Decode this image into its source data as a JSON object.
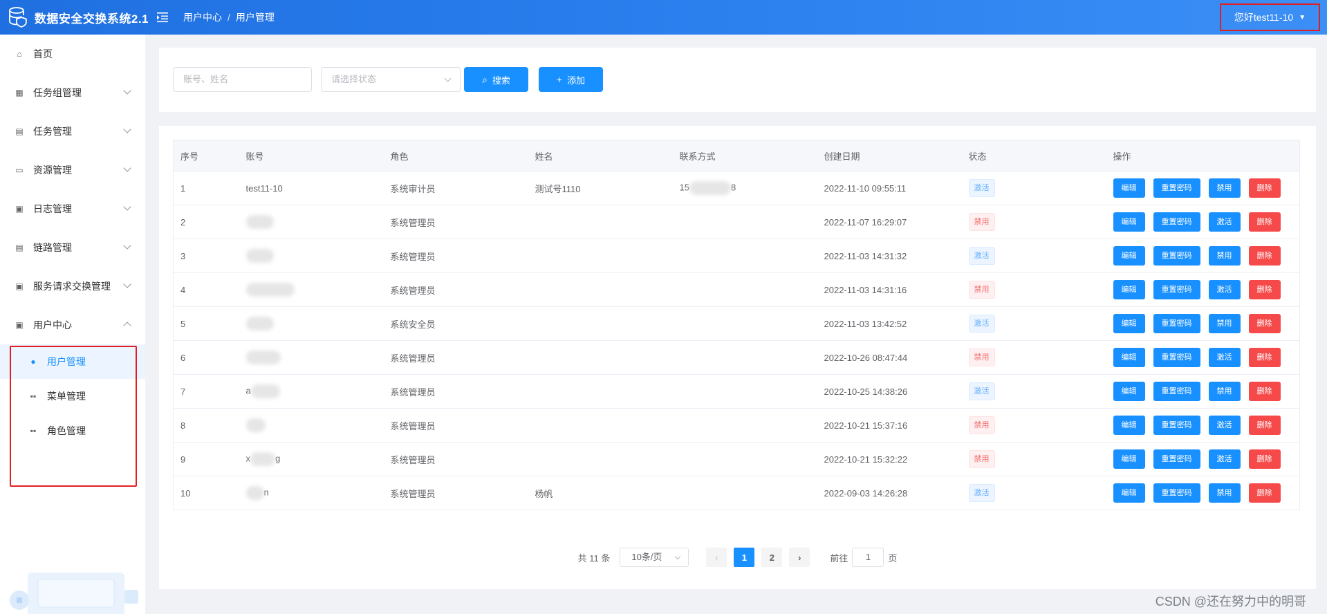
{
  "header": {
    "app_title": "数据安全交换系统2.1",
    "breadcrumb": [
      "用户中心",
      "用户管理"
    ],
    "breadcrumb_sep": "/",
    "user_greeting": "您好test11-10",
    "logo_icon": "database-shield-icon"
  },
  "sidebar": {
    "items": [
      {
        "label": "首页",
        "icon": "home-icon"
      },
      {
        "label": "任务组管理",
        "icon": "grid-icon"
      },
      {
        "label": "任务管理",
        "icon": "document-icon"
      },
      {
        "label": "资源管理",
        "icon": "box-icon"
      },
      {
        "label": "日志管理",
        "icon": "calendar-icon"
      },
      {
        "label": "链路管理",
        "icon": "link-icon"
      },
      {
        "label": "服务请求交换管理",
        "icon": "calendar-icon"
      },
      {
        "label": "用户中心",
        "icon": "calendar-icon",
        "expanded": true
      }
    ],
    "sub_items": [
      {
        "label": "用户管理",
        "icon": "user-icon",
        "active": true
      },
      {
        "label": "菜单管理",
        "icon": "apps-icon"
      },
      {
        "label": "角色管理",
        "icon": "apps-icon"
      }
    ]
  },
  "search": {
    "account_placeholder": "账号、姓名",
    "status_placeholder": "请选择状态",
    "search_label": "搜索",
    "add_label": "添加"
  },
  "table": {
    "columns": [
      "序号",
      "账号",
      "角色",
      "姓名",
      "联系方式",
      "创建日期",
      "状态",
      "操作"
    ],
    "rows": [
      {
        "no": "1",
        "account": "test11-10",
        "role": "系统审计员",
        "name": "测试号1110",
        "contact": "15",
        "contact_tail": "8",
        "date": "2022-11-10 09:55:11",
        "status": "激活",
        "toggle": "禁用"
      },
      {
        "no": "2",
        "account": "",
        "role": "系统管理员",
        "name": "",
        "contact": "",
        "contact_tail": "",
        "date": "2022-11-07 16:29:07",
        "status": "禁用",
        "toggle": "激活"
      },
      {
        "no": "3",
        "account": "",
        "role": "系统管理员",
        "name": "",
        "contact": "",
        "contact_tail": "",
        "date": "2022-11-03 14:31:32",
        "status": "激活",
        "toggle": "禁用"
      },
      {
        "no": "4",
        "account": "",
        "role": "系统管理员",
        "name": "",
        "contact": "",
        "contact_tail": "",
        "date": "2022-11-03 14:31:16",
        "status": "禁用",
        "toggle": "激活"
      },
      {
        "no": "5",
        "account": "",
        "role": "系统安全员",
        "name": "",
        "contact": "",
        "contact_tail": "",
        "date": "2022-11-03 13:42:52",
        "status": "激活",
        "toggle": "禁用"
      },
      {
        "no": "6",
        "account": "",
        "role": "系统管理员",
        "name": "",
        "contact": "",
        "contact_tail": "",
        "date": "2022-10-26 08:47:44",
        "status": "禁用",
        "toggle": "激活"
      },
      {
        "no": "7",
        "account": "a",
        "role": "系统管理员",
        "name": "",
        "contact": "",
        "contact_tail": "",
        "date": "2022-10-25 14:38:26",
        "status": "激活",
        "toggle": "禁用"
      },
      {
        "no": "8",
        "account": "",
        "role": "系统管理员",
        "name": "",
        "contact": "",
        "contact_tail": "",
        "date": "2022-10-21 15:37:16",
        "status": "禁用",
        "toggle": "激活"
      },
      {
        "no": "9",
        "account": "x",
        "account_tail": "g",
        "role": "系统管理员",
        "name": "",
        "contact": "",
        "contact_tail": "",
        "date": "2022-10-21 15:32:22",
        "status": "禁用",
        "toggle": "激活"
      },
      {
        "no": "10",
        "account": "",
        "account_tail": "n",
        "role": "系统管理员",
        "name": "杨帆",
        "contact": "",
        "contact_tail": "",
        "date": "2022-09-03 14:26:28",
        "status": "激活",
        "toggle": "禁用"
      }
    ],
    "op_edit": "编辑",
    "op_reset": "重置密码",
    "op_delete": "删除"
  },
  "pagination": {
    "total": "共 11 条",
    "page_size": "10条/页",
    "pages": [
      "1",
      "2"
    ],
    "current_page": "1",
    "goto_prefix": "前往",
    "goto_value": "1",
    "goto_suffix": "页"
  },
  "watermark": "CSDN @还在努力中的明哥",
  "colors": {
    "primary": "#1890ff",
    "danger": "#f64949",
    "header": "#2d82f0",
    "highlight_box": "#e02020"
  }
}
